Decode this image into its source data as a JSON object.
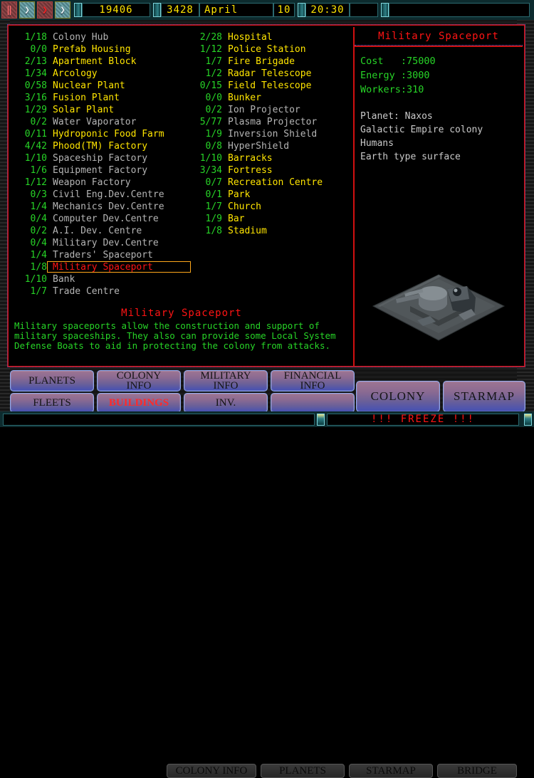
{
  "topbar": {
    "speed_buttons": [
      {
        "name": "pause",
        "glyph": "‖"
      },
      {
        "name": "play",
        "glyph": "❯"
      },
      {
        "name": "fast-forward",
        "glyph": "❯"
      },
      {
        "name": "turbo",
        "glyph": "❯"
      }
    ],
    "credits": "19406",
    "year": "3428",
    "month": "April",
    "day": "10",
    "time": "20:30"
  },
  "buildings": {
    "column_left": [
      {
        "count": "1/18",
        "name": "Colony Hub",
        "state": "dim"
      },
      {
        "count": "0/0",
        "name": "Prefab Housing",
        "state": "avail"
      },
      {
        "count": "2/13",
        "name": "Apartment Block",
        "state": "avail"
      },
      {
        "count": "1/34",
        "name": "Arcology",
        "state": "avail"
      },
      {
        "count": "0/58",
        "name": "Nuclear Plant",
        "state": "avail"
      },
      {
        "count": "3/16",
        "name": "Fusion Plant",
        "state": "avail"
      },
      {
        "count": "1/29",
        "name": "Solar Plant",
        "state": "avail"
      },
      {
        "count": "0/2",
        "name": "Water Vaporator",
        "state": "dim"
      },
      {
        "count": "0/11",
        "name": "Hydroponic Food Farm",
        "state": "avail"
      },
      {
        "count": "4/42",
        "name": "Phood(TM) Factory",
        "state": "avail"
      },
      {
        "count": "1/10",
        "name": "Spaceship Factory",
        "state": "dim"
      },
      {
        "count": "1/6",
        "name": "Equipment Factory",
        "state": "dim"
      },
      {
        "count": "1/12",
        "name": "Weapon Factory",
        "state": "dim"
      },
      {
        "count": "0/3",
        "name": "Civil Eng.Dev.Centre",
        "state": "dim"
      },
      {
        "count": "1/4",
        "name": "Mechanics Dev.Centre",
        "state": "dim"
      },
      {
        "count": "0/4",
        "name": "Computer Dev.Centre",
        "state": "dim"
      },
      {
        "count": "0/2",
        "name": "A.I. Dev. Centre",
        "state": "dim"
      },
      {
        "count": "0/4",
        "name": "Military Dev.Centre",
        "state": "dim"
      },
      {
        "count": "1/4",
        "name": "Traders' Spaceport",
        "state": "dim"
      },
      {
        "count": "1/8",
        "name": "Military Spaceport",
        "state": "selected"
      },
      {
        "count": "1/10",
        "name": "Bank",
        "state": "dim"
      },
      {
        "count": "1/7",
        "name": "Trade Centre",
        "state": "dim"
      }
    ],
    "column_right": [
      {
        "count": "2/28",
        "name": "Hospital",
        "state": "avail"
      },
      {
        "count": "1/12",
        "name": "Police Station",
        "state": "avail"
      },
      {
        "count": "1/7",
        "name": "Fire Brigade",
        "state": "avail"
      },
      {
        "count": "1/2",
        "name": "Radar Telescope",
        "state": "avail"
      },
      {
        "count": "0/15",
        "name": "Field Telescope",
        "state": "avail"
      },
      {
        "count": "0/0",
        "name": "Bunker",
        "state": "avail"
      },
      {
        "count": "0/2",
        "name": "Ion Projector",
        "state": "dim"
      },
      {
        "count": "5/77",
        "name": "Plasma Projector",
        "state": "dim"
      },
      {
        "count": "1/9",
        "name": "Inversion Shield",
        "state": "dim"
      },
      {
        "count": "0/8",
        "name": "HyperShield",
        "state": "dim"
      },
      {
        "count": "1/10",
        "name": "Barracks",
        "state": "avail"
      },
      {
        "count": "3/34",
        "name": "Fortress",
        "state": "avail"
      },
      {
        "count": "0/7",
        "name": "Recreation Centre",
        "state": "avail"
      },
      {
        "count": "0/1",
        "name": "Park",
        "state": "avail"
      },
      {
        "count": "1/7",
        "name": "Church",
        "state": "avail"
      },
      {
        "count": "1/9",
        "name": "Bar",
        "state": "avail"
      },
      {
        "count": "1/8",
        "name": "Stadium",
        "state": "avail"
      }
    ]
  },
  "description": {
    "title": "Military Spaceport",
    "line1": "Military spaceports allow the construction and support of",
    "line2": "military spaceships. They also can provide some Local System",
    "line3": "Defense Boats to aid in protecting the colony from attacks."
  },
  "info": {
    "title": "Military Spaceport",
    "cost_label": "Cost",
    "cost_value": "75000",
    "energy_label": "Energy",
    "energy_value": "3000",
    "workers_label": "Workers",
    "workers_value": "310",
    "cost_line": "Cost   :75000",
    "energy_line": "Energy :3000",
    "workers_line": "Workers:310",
    "planet_line": "Planet: Naxos",
    "owner_line": "Galactic Empire colony",
    "race_line": "Humans",
    "surface_line": "Earth type surface"
  },
  "buttons": {
    "row1": [
      {
        "label": "PLANETS",
        "active": false
      },
      {
        "label": "COLONY\nINFO",
        "active": false
      },
      {
        "label": "MILITARY\nINFO",
        "active": false
      },
      {
        "label": "FINANCIAL\nINFO",
        "active": false
      }
    ],
    "row2": [
      {
        "label": "FLEETS",
        "active": false
      },
      {
        "label": "BUILDINGS",
        "active": true
      },
      {
        "label": "INV.",
        "active": false
      },
      {
        "label": "",
        "active": false
      }
    ],
    "right": [
      {
        "label": "COLONY"
      },
      {
        "label": "STARMAP"
      }
    ],
    "background_row": [
      {
        "label": "COLONY INFO"
      },
      {
        "label": "PLANETS"
      },
      {
        "label": "STARMAP"
      },
      {
        "label": "BRIDGE"
      }
    ]
  },
  "status": {
    "message": "!!! FREEZE !!!",
    "left_text": ""
  },
  "colors": {
    "red_border": "#d01010",
    "green_text": "#27d427",
    "yellow_text": "#ffe500",
    "dim_text": "#b5b5b5",
    "select_box": "#ffa81b",
    "lcd_yellow": "#ffe400",
    "panel_teal": "#0d2b2e"
  }
}
